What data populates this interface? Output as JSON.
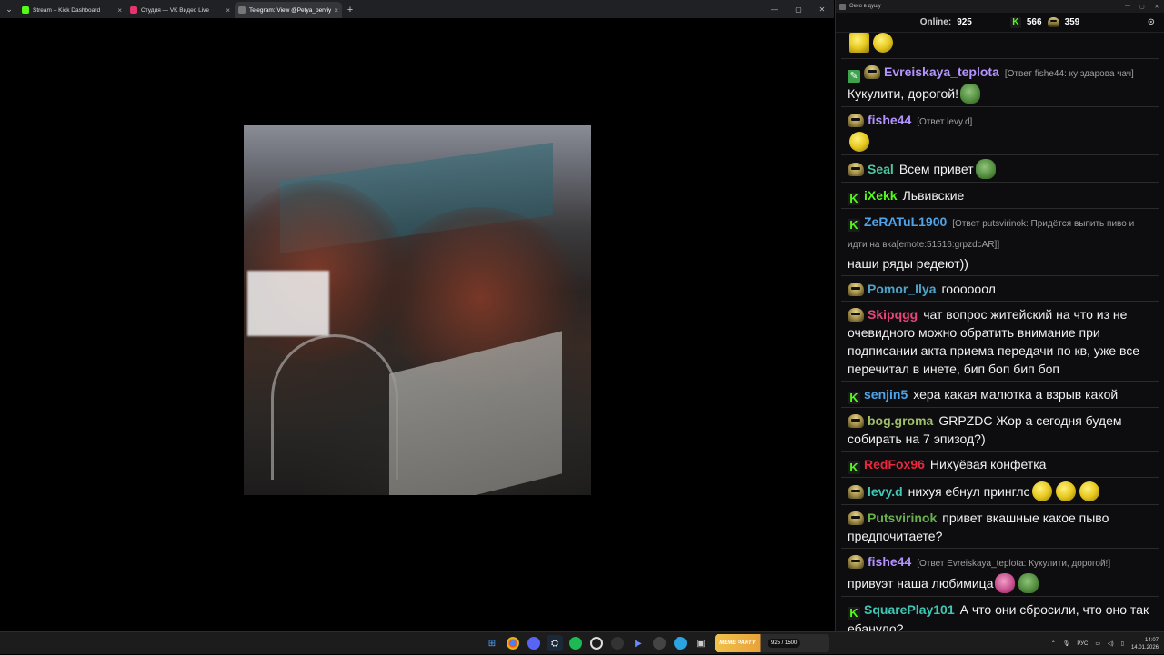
{
  "browser": {
    "tabs": [
      {
        "title": "Stream – Kick Dashboard",
        "fav_color": "#53fc18",
        "active": false
      },
      {
        "title": "Студия — VK Видео Live",
        "fav_color": "#e4356e",
        "active": false
      },
      {
        "title": "Telegram: View @Petya_perviy",
        "fav_color": "#777777",
        "active": true
      }
    ],
    "new_tab": "+",
    "close": "×"
  },
  "chat_window": {
    "title": "Окно в душу",
    "online_label": "Online:",
    "online_count": "925",
    "kick_count": "566",
    "vk_count": "359"
  },
  "messages": [
    {
      "badges": [
        "pencil",
        "gob"
      ],
      "user": "Evreiskaya_teplota",
      "color": "#b394ff",
      "reply": "[Ответ fishe44: ку здарова чач]",
      "text": "Кукулити, дорогой!",
      "emotes": [
        "pepe"
      ]
    },
    {
      "badges": [
        "gob"
      ],
      "user": "fishe44",
      "color": "#b394ff",
      "reply": "[Ответ levy.d]",
      "text": "",
      "emotes": [
        "yellow"
      ]
    },
    {
      "badges": [
        "gob"
      ],
      "user": "Seal",
      "color": "#4fc7a0",
      "reply": "",
      "text": "Всем привет",
      "emotes": [
        "pepe"
      ]
    },
    {
      "badges": [
        "k"
      ],
      "user": "iXekk",
      "color": "#53fc18",
      "reply": "",
      "text": "Львивские",
      "emotes": []
    },
    {
      "badges": [
        "k"
      ],
      "user": "ZeRATuL1900",
      "color": "#4fa3e8",
      "reply": "[Ответ putsvirinok: Придётся выпить пиво и идти на вка[emote:51516:grpzdcAR]]",
      "text": "наши ряды редеют))",
      "emotes": []
    },
    {
      "badges": [
        "gob"
      ],
      "user": "Pomor_Ilya",
      "color": "#4fa3c8",
      "reply": "",
      "text": "гоооооол",
      "emotes": []
    },
    {
      "badges": [
        "gob"
      ],
      "user": "Skipqgg",
      "color": "#e8467a",
      "reply": "",
      "text": "чат вопрос житейский на что из не очевидного можно обратить внимание при подписании акта приема передачи по кв, уже все перечитал в инете, бип боп бип боп",
      "emotes": []
    },
    {
      "badges": [
        "k"
      ],
      "user": "senjin5",
      "color": "#4fa3e8",
      "reply": "",
      "text": "хера какая малютка а взрыв какой",
      "emotes": []
    },
    {
      "badges": [
        "gob"
      ],
      "user": "bog.groma",
      "color": "#9fbf6a",
      "reply": "",
      "text": "GRPZDC Жор а сегодня будем собирать на 7 эпизод?)",
      "emotes": []
    },
    {
      "badges": [
        "k"
      ],
      "user": "RedFox96",
      "color": "#e8283c",
      "reply": "",
      "text": "Нихуёвая конфетка",
      "emotes": []
    },
    {
      "badges": [
        "gob"
      ],
      "user": "levy.d",
      "color": "#3fc7b4",
      "reply": "",
      "text": "нихуя ебнул принглс",
      "emotes": [
        "yellow",
        "yellow",
        "yellow"
      ]
    },
    {
      "badges": [
        "gob"
      ],
      "user": "Putsvirinok",
      "color": "#6ab04c",
      "reply": "",
      "text": "привет вкашные какое пыво предпочитаете?",
      "emotes": []
    },
    {
      "badges": [
        "gob"
      ],
      "user": "fishe44",
      "color": "#b394ff",
      "reply": "[Ответ Evreiskaya_teplota: Кукулити, дорогой!]",
      "text": "привуэт наша любимица",
      "emotes": [
        "pink",
        "pepe"
      ]
    },
    {
      "badges": [
        "k"
      ],
      "user": "SquarePlay101",
      "color": "#3fc7b4",
      "reply": "",
      "text": "А что они сбросили, что оно так ебануло?",
      "emotes": []
    }
  ],
  "taskbar": {
    "widget_title": "MEME PARTY",
    "widget_count": "925 / 1500",
    "lang": "РУС",
    "time": "14:07",
    "date": "14.01.2026"
  }
}
